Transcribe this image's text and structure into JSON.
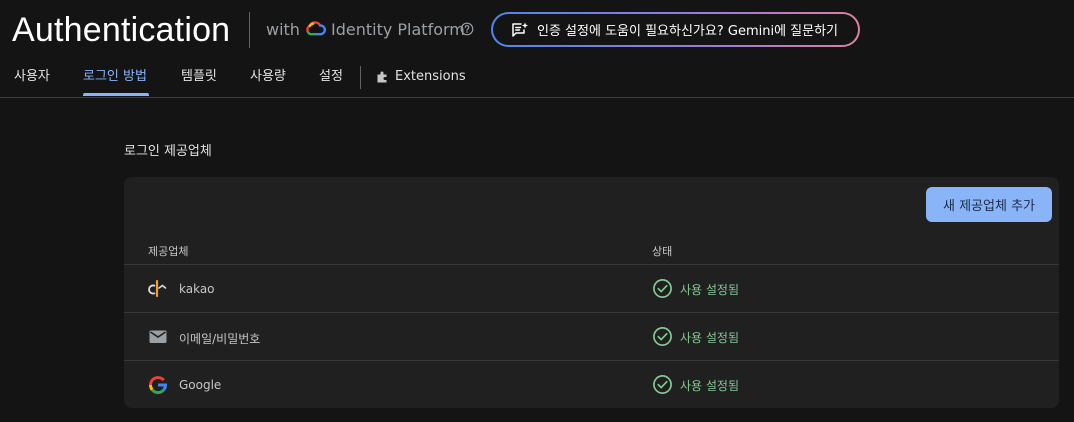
{
  "header": {
    "title": "Authentication",
    "with_label": "with",
    "platform_label": "Identity Platform",
    "gemini_button_label": "인증 설정에 도움이 필요하신가요? Gemini에 질문하기"
  },
  "tabs": [
    {
      "label": "사용자",
      "active": false
    },
    {
      "label": "로그인 방법",
      "active": true
    },
    {
      "label": "템플릿",
      "active": false
    },
    {
      "label": "사용량",
      "active": false
    },
    {
      "label": "설정",
      "active": false
    },
    {
      "label": "Extensions",
      "active": false
    }
  ],
  "providers_section": {
    "title": "로그인 제공업체",
    "add_button_label": "새 제공업체 추가",
    "columns": [
      "제공업체",
      "상태"
    ],
    "rows": [
      {
        "icon": "kakao-icon",
        "name": "kakao",
        "status": "사용 설정됨"
      },
      {
        "icon": "mail-icon",
        "name": "이메일/비밀번호",
        "status": "사용 설정됨"
      },
      {
        "icon": "google-icon",
        "name": "Google",
        "status": "사용 설정됨"
      }
    ]
  },
  "colors": {
    "background": "#141414",
    "card": "#202020",
    "accent": "#8ab4f8",
    "enabled_status": "#81c995"
  }
}
